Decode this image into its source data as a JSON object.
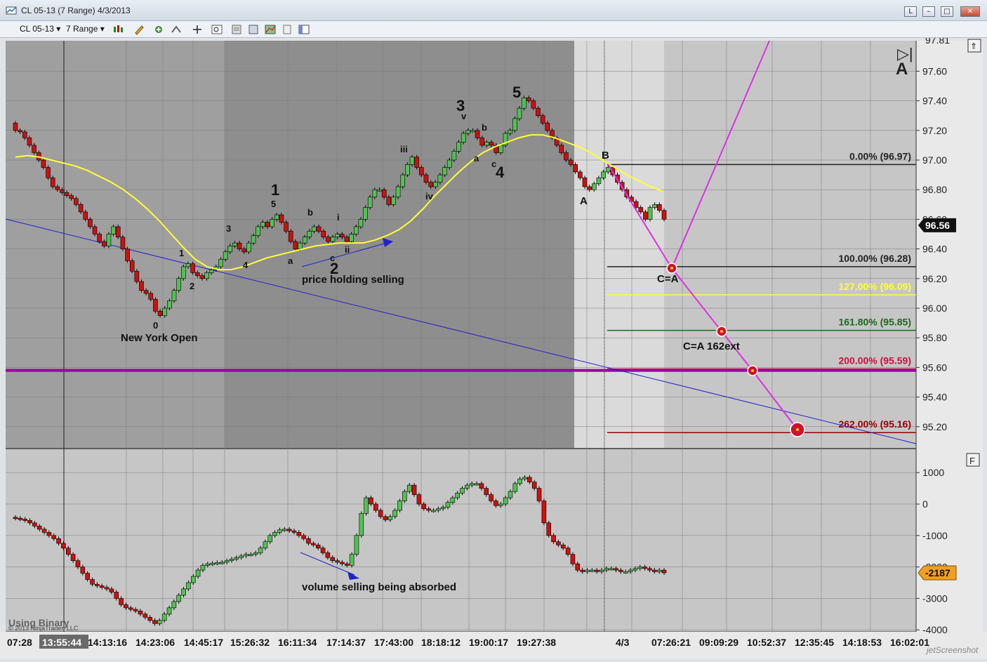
{
  "window": {
    "title": "CL 05-13 (7 Range)  4/3/2013",
    "buttons": [
      "L",
      "–",
      "□",
      "✕"
    ]
  },
  "toolbar": {
    "instrument": "CL 05-13",
    "period": "7 Range"
  },
  "colors": {
    "candle_up": "#52c152",
    "candle_down": "#cc1010",
    "sma": "#ffff33",
    "trend": "#2222cc",
    "projection": "#e030e0",
    "level_purple": "#990099"
  },
  "chart_data": [
    {
      "type": "candlestick",
      "panel": "price",
      "ylim": [
        95.0,
        97.85
      ],
      "y_ticks": [
        "97.60",
        "97.40",
        "97.20",
        "97.00",
        "96.80",
        "96.60",
        "96.40",
        "96.20",
        "96.00",
        "95.80",
        "95.60",
        "95.40",
        "95.20"
      ],
      "top_tick": "97.81",
      "last_price": "96.56",
      "series": [
        {
          "name": "",
          "close": [
            97.2,
            97.19,
            97.15,
            97.1,
            97.05,
            97.0,
            96.95,
            96.88,
            96.82,
            96.8,
            96.78,
            96.76,
            96.74,
            96.7,
            96.65,
            96.6,
            96.55,
            96.5,
            96.45,
            96.42,
            96.5,
            96.55,
            96.48,
            96.4,
            96.32,
            96.25,
            96.18,
            96.12,
            96.1,
            96.06,
            95.98,
            95.95,
            96.0,
            96.05,
            96.12,
            96.2,
            96.28,
            96.3,
            96.24,
            96.22,
            96.2,
            96.24,
            96.26,
            96.28,
            96.33,
            96.38,
            96.42,
            96.44,
            96.4,
            96.38,
            96.44,
            96.49,
            96.55,
            96.58,
            96.55,
            96.6,
            96.63,
            96.58,
            96.52,
            96.45,
            96.4,
            96.44,
            96.48,
            96.52,
            96.55,
            96.52,
            96.48,
            96.45,
            96.48,
            96.5,
            96.48,
            96.45,
            96.5,
            96.55,
            96.6,
            96.68,
            96.75,
            96.8,
            96.8,
            96.75,
            96.7,
            96.75,
            96.82,
            96.9,
            96.97,
            97.02,
            96.95,
            96.9,
            96.85,
            96.82,
            96.85,
            96.9,
            96.95,
            97.0,
            97.06,
            97.12,
            97.18,
            97.2,
            97.2,
            97.15,
            97.1,
            97.12,
            97.1,
            97.05,
            97.1,
            97.18,
            97.2,
            97.28,
            97.35,
            97.42,
            97.4,
            97.35,
            97.3,
            97.25,
            97.2,
            97.15,
            97.1,
            97.05,
            97.0,
            96.97,
            96.92,
            96.88,
            96.82,
            96.8,
            96.84,
            96.88,
            96.92,
            96.95,
            96.9,
            96.85,
            96.8,
            96.75,
            96.72,
            96.68,
            96.65,
            96.6,
            96.68,
            96.7,
            96.66,
            96.6
          ]
        }
      ],
      "sma": {
        "name": "",
        "values": [
          97.02,
          97.03,
          97.02,
          97.0,
          96.98,
          96.96,
          96.93,
          96.89,
          96.85,
          96.8,
          96.74,
          96.67,
          96.59,
          96.5,
          96.41,
          96.33,
          96.28,
          96.26,
          96.26,
          96.28,
          96.31,
          96.34,
          96.36,
          96.38,
          96.4,
          96.42,
          96.43,
          96.44,
          96.44,
          96.44,
          96.46,
          96.49,
          96.53,
          96.59,
          96.67,
          96.76,
          96.84,
          96.92,
          96.99,
          97.05,
          97.09,
          97.12,
          97.15,
          97.17,
          97.17,
          97.15,
          97.12,
          97.09,
          97.05,
          97.0,
          96.95,
          96.9,
          96.86,
          96.82,
          96.79
        ]
      },
      "wave_labels": [
        "0",
        "1",
        "2",
        "3",
        "4",
        "5",
        "1",
        "a",
        "b",
        "c",
        "i",
        "ii",
        "2",
        "iii",
        "iv",
        "3",
        "v",
        "a",
        "b",
        "c",
        "4",
        "5",
        "A",
        "B",
        "C=A",
        "C=A 162ext"
      ],
      "annotations": [
        "New York Open",
        "price holding selling"
      ],
      "fib_levels": [
        {
          "label": "0.00% (96.97)",
          "value": 96.97
        },
        {
          "label": "100.00% (96.28)",
          "value": 96.28
        },
        {
          "label": "127.00% (96.09)",
          "value": 96.09
        },
        {
          "label": "161.80% (95.85)",
          "value": 95.85
        },
        {
          "label": "200.00% (95.59)",
          "value": 95.59
        },
        {
          "label": "262.00% (95.16)",
          "value": 95.16
        }
      ],
      "horizontal_line": 95.58
    },
    {
      "type": "candlestick",
      "panel": "volume-delta",
      "ylim": [
        -4000,
        1500
      ],
      "y_ticks": [
        "1000",
        "0",
        "-1000",
        "-2000",
        "-3000",
        "-4000"
      ],
      "last_value": "-2187",
      "annotation": "volume selling being absorbed",
      "series": [
        {
          "name": "",
          "close": [
            -450,
            -480,
            -520,
            -600,
            -700,
            -800,
            -900,
            -1000,
            -1100,
            -1250,
            -1400,
            -1600,
            -1800,
            -2000,
            -2200,
            -2400,
            -2550,
            -2600,
            -2650,
            -2700,
            -2800,
            -3000,
            -3200,
            -3300,
            -3350,
            -3400,
            -3500,
            -3600,
            -3700,
            -3800,
            -3700,
            -3500,
            -3300,
            -3100,
            -2900,
            -2700,
            -2500,
            -2300,
            -2100,
            -1950,
            -1900,
            -1880,
            -1860,
            -1850,
            -1800,
            -1750,
            -1700,
            -1650,
            -1600,
            -1600,
            -1550,
            -1400,
            -1200,
            -1000,
            -900,
            -820,
            -800,
            -850,
            -900,
            -1000,
            -1100,
            -1250,
            -1300,
            -1400,
            -1550,
            -1700,
            -1800,
            -1850,
            -1900,
            -1950,
            -1600,
            -1000,
            -300,
            200,
            0,
            -200,
            -400,
            -500,
            -400,
            -200,
            100,
            400,
            600,
            300,
            0,
            -150,
            -200,
            -200,
            -150,
            -100,
            50,
            200,
            350,
            500,
            600,
            650,
            650,
            500,
            300,
            100,
            -50,
            0,
            200,
            400,
            650,
            800,
            850,
            700,
            500,
            100,
            -600,
            -1000,
            -1200,
            -1300,
            -1400,
            -1600,
            -1900,
            -2100,
            -2150,
            -2100,
            -2100,
            -2150,
            -2100,
            -2050,
            -2050,
            -2100,
            -2150,
            -2150,
            -2100,
            -2050,
            -2000,
            -2050,
            -2100,
            -2150,
            -2100,
            -2187
          ]
        }
      ]
    }
  ],
  "x_axis": {
    "labels": [
      "07:28",
      "13:55:44",
      "14:13:16",
      "14:23:06",
      "14:45:17",
      "15:26:32",
      "16:11:34",
      "17:14:37",
      "17:43:00",
      "18:18:12",
      "19:00:17",
      "19:27:38",
      "4/3",
      "07:26:21",
      "09:09:29",
      "10:52:37",
      "12:35:45",
      "14:18:53",
      "16:02:01"
    ],
    "highlighted": "13:55:44"
  },
  "panel_badges": {
    "price": "A",
    "lower": "F"
  },
  "watermark": {
    "text": "Using Binary",
    "copyright": "© 2013 NinjaTrader, LLC",
    "brand": "jetScreenshot"
  }
}
